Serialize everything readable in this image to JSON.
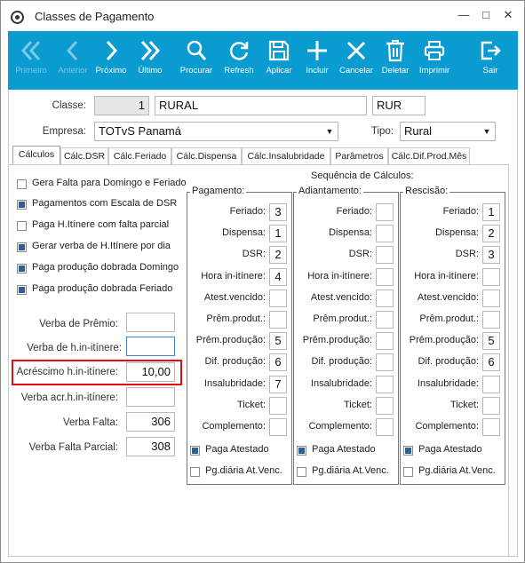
{
  "window": {
    "title": "Classes de Pagamento"
  },
  "toolbar": [
    {
      "label": "Primeiro",
      "icon": "first-icon",
      "disabled": true
    },
    {
      "label": "Anterior",
      "icon": "previous-icon",
      "disabled": true
    },
    {
      "label": "Próximo",
      "icon": "next-icon",
      "disabled": false
    },
    {
      "label": "Último",
      "icon": "last-icon",
      "disabled": false
    },
    {
      "label": "Procurar",
      "icon": "search-icon",
      "disabled": false
    },
    {
      "label": "Refresh",
      "icon": "refresh-icon",
      "disabled": false
    },
    {
      "label": "Aplicar",
      "icon": "save-icon",
      "disabled": false
    },
    {
      "label": "Incluir",
      "icon": "plus-icon",
      "disabled": false
    },
    {
      "label": "Cancelar",
      "icon": "close-icon",
      "disabled": false
    },
    {
      "label": "Deletar",
      "icon": "trash-icon",
      "disabled": false
    },
    {
      "label": "Imprimir",
      "icon": "printer-icon",
      "disabled": false
    },
    {
      "label": "Sair",
      "icon": "exit-icon",
      "disabled": false
    }
  ],
  "form": {
    "classe_label": "Classe:",
    "classe_code": "1",
    "classe_name": "RURAL",
    "classe_abbr": "RUR",
    "empresa_label": "Empresa:",
    "empresa_value": "TOTvS Panamá",
    "tipo_label": "Tipo:",
    "tipo_value": "Rural"
  },
  "tabs": [
    "Cálculos",
    "Cálc.DSR",
    "Cálc.Feriado",
    "Cálc.Dispensa",
    "Cálc.Insalubridade",
    "Parâmetros",
    "Cálc.Dif.Prod.Mês"
  ],
  "checkboxes": [
    {
      "label": "Gera Falta para Domingo e Feriado",
      "checked": false
    },
    {
      "label": "Pagamentos com Escala de DSR",
      "checked": true
    },
    {
      "label": "Paga H.Itínere com falta parcial",
      "checked": false
    },
    {
      "label": "Gerar verba de H.Itínere por dia",
      "checked": true
    },
    {
      "label": "Paga produção dobrada Domingo",
      "checked": true
    },
    {
      "label": "Paga produção dobrada Feriado",
      "checked": true
    }
  ],
  "verbas": [
    {
      "label": "Verba de Prêmio:",
      "value": ""
    },
    {
      "label": "Verba de h.in-itínere:",
      "value": ""
    },
    {
      "label": "Acréscimo h.in-itínere:",
      "value": "10,00"
    },
    {
      "label": "Verba acr.h.in-itínere:",
      "value": ""
    },
    {
      "label": "Verba Falta:",
      "value": "306"
    },
    {
      "label": "Verba Falta Parcial:",
      "value": "308"
    }
  ],
  "sequencia_title": "Sequência de Cálculos:",
  "row_labels": [
    "Feriado:",
    "Dispensa:",
    "DSR:",
    "Hora in-itínere:",
    "Atest.vencido:",
    "Prêm.produt.:",
    "Prêm.produção:",
    "Dif. produção:",
    "Insalubridade:",
    "Ticket:",
    "Complemento:"
  ],
  "groups": [
    {
      "title": "Pagamento:",
      "values": [
        "3",
        "1",
        "2",
        "4",
        "",
        "",
        "5",
        "6",
        "7",
        "",
        ""
      ],
      "paga_atestado": true,
      "pg_diaria": false
    },
    {
      "title": "Adiantamento:",
      "values": [
        "",
        "",
        "",
        "",
        "",
        "",
        "",
        "",
        "",
        "",
        ""
      ],
      "paga_atestado": true,
      "pg_diaria": false
    },
    {
      "title": "Rescisão:",
      "values": [
        "1",
        "2",
        "3",
        "",
        "",
        "",
        "5",
        "6",
        "",
        "",
        ""
      ],
      "paga_atestado": true,
      "pg_diaria": false
    }
  ],
  "paga_atestado_label": "Paga Atestado",
  "pg_diaria_label": "Pg.diária At.Venc."
}
